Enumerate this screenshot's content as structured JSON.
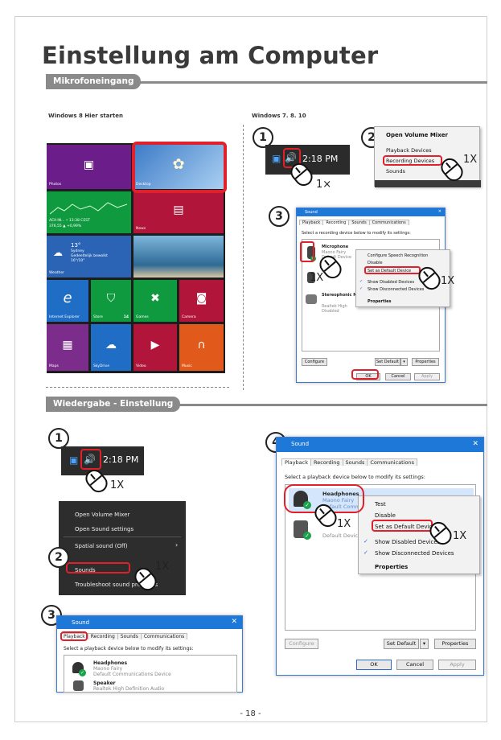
{
  "title": "Einstellung am Computer",
  "sections": {
    "mic": "Mikrofoneingang",
    "playback": "Wiedergabe - Einstellung"
  },
  "win8_label": "Windows 8 Hier starten",
  "win7_label": "Windows 7. 8. 10",
  "start_tiles": {
    "photos": "Photos",
    "desktop": "Desktop",
    "finance": "AEX-IN... • 13:38 CEST",
    "finance2": "376,55 ▲ +0,99%",
    "news": "News",
    "weather_temp": "13°",
    "weather_city": "Sydney",
    "weather_desc": "Gedeeltelijk bewolkt",
    "weather_range": "16°/10°",
    "weather": "Weather",
    "ie": "Internet Explorer",
    "store": "Store",
    "store_count": "14",
    "games": "Games",
    "camera": "Camera",
    "maps": "Maps",
    "skydrive": "SkyDrive",
    "video": "Video",
    "music": "Music"
  },
  "steps": [
    "1",
    "2",
    "3",
    "4"
  ],
  "clock": "2:18 PM",
  "click_1x_a": "1×",
  "click_1x": "1X",
  "volume_menu": [
    "Open Volume Mixer",
    "Playback Devices",
    "Recording Devices",
    "Sounds"
  ],
  "rec_dialog": {
    "title": "Sound",
    "tabs": [
      "Playback",
      "Recording",
      "Sounds",
      "Communications"
    ],
    "instruction": "Select a recording device below to modify its settings:",
    "dev1_name": "Microphone",
    "dev1_sub1": "Maono Fairy",
    "dev1_sub2": "Default Device",
    "dev2_name": "Stereophonic Mixing",
    "dev2_sub1": "Realtek High",
    "dev2_sub2": "Disabled",
    "menu": [
      "Configure Speech Recognition",
      "Disable",
      "Set as Default Device",
      "Show Disabled Devices",
      "Show Disconnected Devices",
      "Properties"
    ],
    "configure": "Configure",
    "set_default": "Set Default",
    "properties": "Properties",
    "ok": "OK",
    "cancel": "Cancel",
    "apply": "Apply"
  },
  "win10_menu": [
    "Open Volume Mixer",
    "Open Sound settings",
    "Spatial sound (Off)",
    "Sounds",
    "Troubleshoot sound problems"
  ],
  "play_dialog_small": {
    "title": "Sound",
    "tabs": [
      "Playback",
      "Recording",
      "Sounds",
      "Communications"
    ],
    "instruction": "Select a playback device below to modify its settings:",
    "dev1_name": "Headphones",
    "dev1_sub1": "Maono Fairy",
    "dev1_sub2": "Default Communications Device",
    "dev2_name": "Speaker",
    "dev2_sub1": "Realtek High Definition Audio"
  },
  "play_dialog": {
    "title": "Sound",
    "tabs": [
      "Playback",
      "Recording",
      "Sounds",
      "Communications"
    ],
    "instruction": "Select a playback device below to modify its settings:",
    "dev1_name": "Headphones",
    "dev1_sub1": "Maono Fairy",
    "dev1_sub2": "Default Comm",
    "dev2_sub": "Default Devic",
    "menu": [
      "Test",
      "Disable",
      "Set as Default Device",
      "Show Disabled Devices",
      "Show Disconnected Devices",
      "Properties"
    ],
    "configure": "Configure",
    "set_default": "Set Default",
    "properties": "Properties",
    "ok": "OK",
    "cancel": "Cancel",
    "apply": "Apply"
  },
  "page_number": "- 18 -",
  "colors": {
    "accent_red": "#e0202a",
    "win_blue": "#1e78d7",
    "section_gray": "#8a8a8a"
  }
}
